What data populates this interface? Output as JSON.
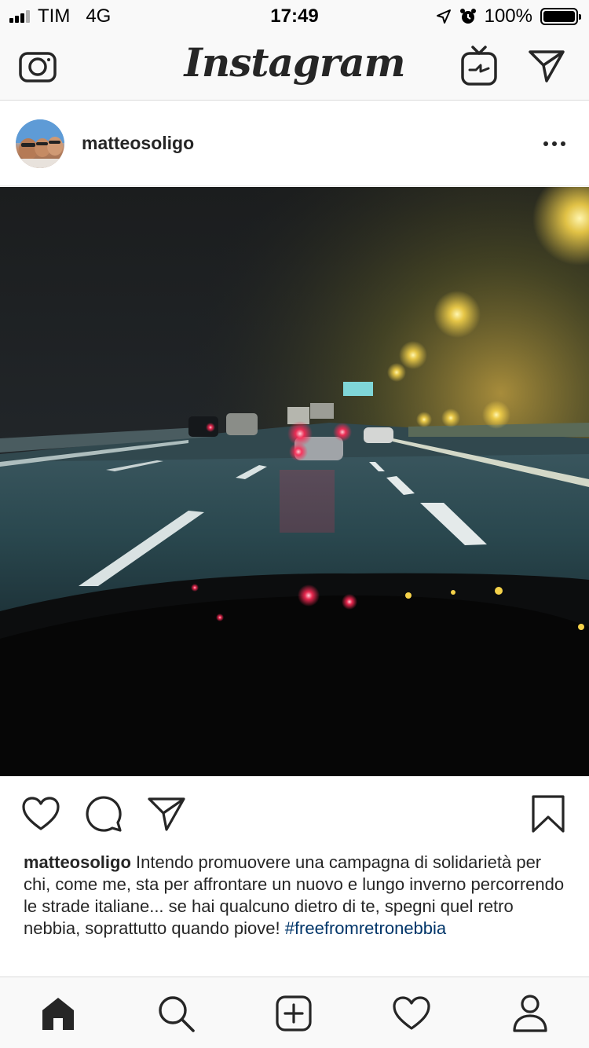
{
  "status_bar": {
    "carrier": "TIM",
    "network": "4G",
    "time": "17:49",
    "battery": "100%",
    "signal_bars_active": 3,
    "signal_bars_total": 4,
    "battery_level": 1.0
  },
  "header": {
    "logo": "Instagram",
    "icons": [
      "camera-icon",
      "igtv-icon",
      "direct-message-icon"
    ]
  },
  "post": {
    "username": "matteosoligo",
    "more_icon": "more-options-icon",
    "photo": "night-highway-fog-photo",
    "actions": [
      "like-icon",
      "comment-icon",
      "share-icon",
      "bookmark-icon"
    ],
    "caption": {
      "username": "matteosoligo",
      "text": " Intendo promuovere una campagna di solidarietà per chi, come me, sta per affrontare un nuovo e lungo inverno percorrendo le strade italiane... se hai qualcuno dietro di te, spegni quel retro nebbia, soprattutto quando piove! ",
      "hashtag": "#freefromretronebbia"
    }
  },
  "bottom_nav": {
    "items": [
      "home-icon",
      "search-icon",
      "add-post-icon",
      "activity-icon",
      "profile-icon"
    ]
  },
  "colors": {
    "bar_background": "#f9f9f9",
    "text": "#262626",
    "hashtag": "#003569",
    "divider": "#dbdbdb"
  }
}
